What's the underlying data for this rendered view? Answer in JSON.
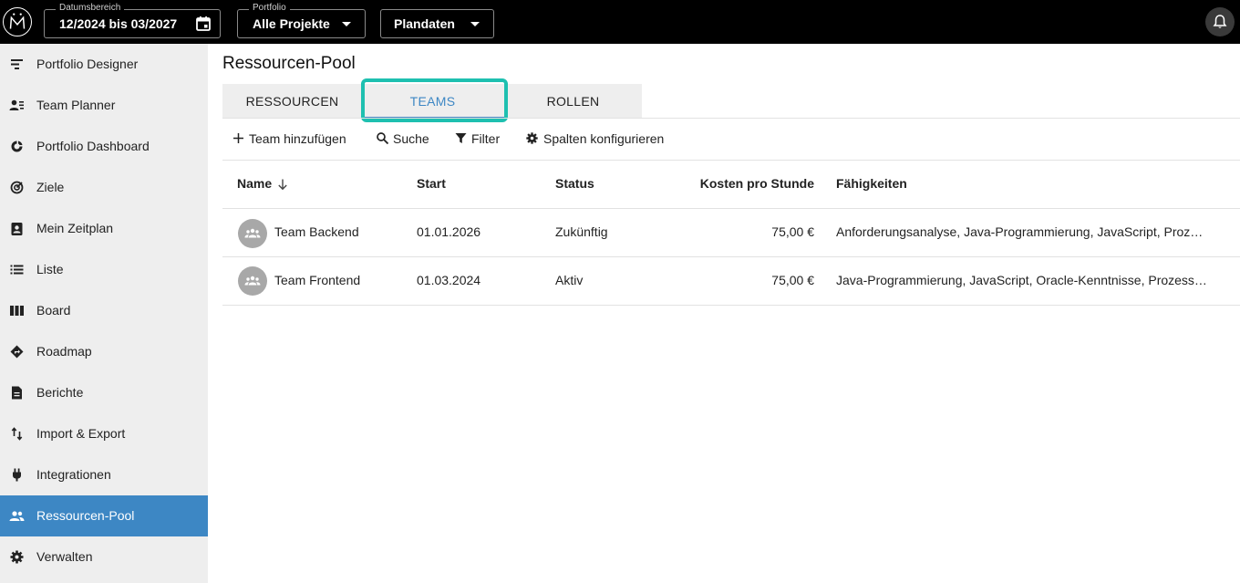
{
  "header": {
    "date_range": {
      "legend": "Datumsbereich",
      "value": "12/2024 bis 03/2027"
    },
    "portfolio": {
      "legend": "Portfolio",
      "value": "Alle Projekte"
    },
    "data_mode": {
      "value": "Plandaten"
    },
    "icons": {
      "logo": "logo-icon",
      "calendar": "calendar-icon",
      "bell": "bell-icon"
    }
  },
  "sidebar": {
    "items": [
      {
        "label": "Portfolio Designer",
        "icon": "portfolio-designer-icon"
      },
      {
        "label": "Team Planner",
        "icon": "team-planner-icon"
      },
      {
        "label": "Portfolio Dashboard",
        "icon": "dashboard-icon"
      },
      {
        "label": "Ziele",
        "icon": "target-icon"
      },
      {
        "label": "Mein Zeitplan",
        "icon": "schedule-icon"
      },
      {
        "label": "Liste",
        "icon": "list-icon"
      },
      {
        "label": "Board",
        "icon": "board-icon"
      },
      {
        "label": "Roadmap",
        "icon": "roadmap-icon"
      },
      {
        "label": "Berichte",
        "icon": "report-icon"
      },
      {
        "label": "Import & Export",
        "icon": "import-export-icon"
      },
      {
        "label": "Integrationen",
        "icon": "plug-icon"
      },
      {
        "label": "Ressourcen-Pool",
        "icon": "people-icon",
        "active": true
      },
      {
        "label": "Verwalten",
        "icon": "gear-icon"
      }
    ],
    "active_color": "#3d87c4"
  },
  "main": {
    "title": "Ressourcen-Pool",
    "tabs": [
      {
        "label": "RESSOURCEN"
      },
      {
        "label": "TEAMS",
        "active": true
      },
      {
        "label": "ROLLEN"
      }
    ],
    "highlight_color": "#1ec0b0",
    "toolbar": {
      "add": "Team hinzufügen",
      "search": "Suche",
      "filter": "Filter",
      "columns": "Spalten konfigurieren"
    },
    "table": {
      "headers": [
        "Name",
        "Start",
        "Status",
        "Kosten pro Stunde",
        "Fähigkeiten"
      ],
      "sort": "descending",
      "rows": [
        {
          "name": "Team Backend",
          "start": "01.01.2026",
          "status": "Zukünftig",
          "cost": "75,00 €",
          "skills": "Anforderungsanalyse, Java-Programmierung, JavaScript, Proz…"
        },
        {
          "name": "Team Frontend",
          "start": "01.03.2024",
          "status": "Aktiv",
          "cost": "75,00 €",
          "skills": "Java-Programmierung, JavaScript, Oracle-Kenntnisse, Prozess…"
        }
      ]
    }
  }
}
